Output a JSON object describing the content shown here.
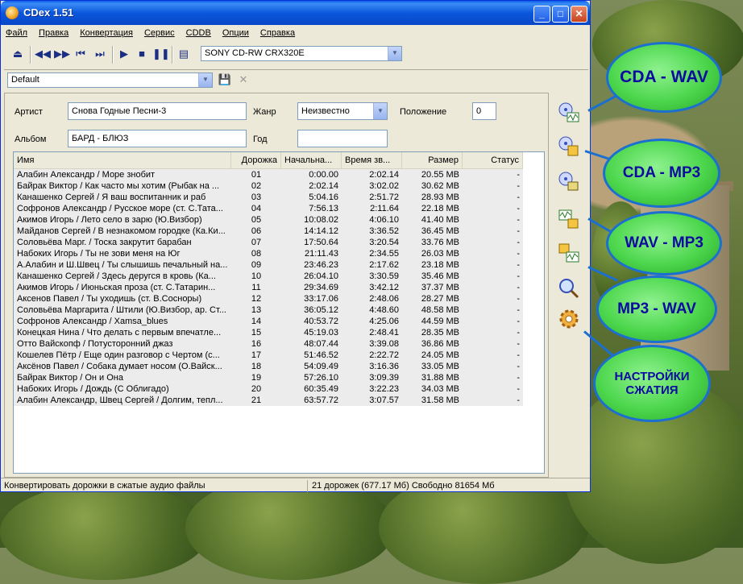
{
  "window": {
    "title": "CDex 1.51"
  },
  "menu": [
    "Файл",
    "Правка",
    "Конвертация",
    "Сервис",
    "CDDB",
    "Опции",
    "Справка"
  ],
  "toolbar": {
    "drive": "SONY    CD-RW  CRX320E"
  },
  "profile": {
    "value": "Default"
  },
  "form": {
    "artist_label": "Артист",
    "artist_value": "Снова Годные Песни-3",
    "genre_label": "Жанр",
    "genre_value": "Неизвестно",
    "position_label": "Положение",
    "position_value": "0",
    "album_label": "Альбом",
    "album_value": "БАРД - БЛЮЗ",
    "year_label": "Год",
    "year_value": ""
  },
  "table": {
    "columns": [
      "Имя",
      "Дорожка",
      "Начальна...",
      "Время зв...",
      "Размер",
      "Статус"
    ],
    "rows": [
      [
        "Алабин Александр / Море знобит",
        "01",
        "0:00.00",
        "2:02.14",
        "20.55 MB",
        "-"
      ],
      [
        "Байрак Виктор / Как часто мы хотим (Рыбак на ...",
        "02",
        "2:02.14",
        "3:02.02",
        "30.62 MB",
        "-"
      ],
      [
        "Канашенко Сергей / Я ваш воспитанник и раб",
        "03",
        "5:04.16",
        "2:51.72",
        "28.93 MB",
        "-"
      ],
      [
        "Софронов Александр / Русское море (ст. С.Тата...",
        "04",
        "7:56.13",
        "2:11.64",
        "22.18 MB",
        "-"
      ],
      [
        "Акимов Игорь / Лето село в зарю (Ю.Визбор)",
        "05",
        "10:08.02",
        "4:06.10",
        "41.40 MB",
        "-"
      ],
      [
        "Майданов Сергей / В незнакомом городке (Ка.Ки...",
        "06",
        "14:14.12",
        "3:36.52",
        "36.45 MB",
        "-"
      ],
      [
        "Соловьёва Марг. / Тоска закрутит барабан",
        "07",
        "17:50.64",
        "3:20.54",
        "33.76 MB",
        "-"
      ],
      [
        "Набоких Игорь / Ты не зови меня на Юг",
        "08",
        "21:11.43",
        "2:34.55",
        "26.03 MB",
        "-"
      ],
      [
        "А.Алабин и Ш.Швец / Ты слышишь печальный на...",
        "09",
        "23:46.23",
        "2:17.62",
        "23.18 MB",
        "-"
      ],
      [
        "Канашенко Сергей / Здесь деругся в кровь (Ка...",
        "10",
        "26:04.10",
        "3:30.59",
        "35.46 MB",
        "-"
      ],
      [
        "Акимов Игорь / Июньская проза (ст. С.Татарин...",
        "11",
        "29:34.69",
        "3:42.12",
        "37.37 MB",
        "-"
      ],
      [
        "Аксенов Павел / Ты уходишь (ст. В.Сосноры)",
        "12",
        "33:17.06",
        "2:48.06",
        "28.27 MB",
        "-"
      ],
      [
        "Соловьёва Маргарита / Штили (Ю.Визбор, ар. Ст...",
        "13",
        "36:05.12",
        "4:48.60",
        "48.58 MB",
        "-"
      ],
      [
        "Софронов Александр / Xamsa_blues",
        "14",
        "40:53.72",
        "4:25.06",
        "44.59 MB",
        "-"
      ],
      [
        "Конецкая Нина / Что делать с первым впечатле...",
        "15",
        "45:19.03",
        "2:48.41",
        "28.35 MB",
        "-"
      ],
      [
        "Отто Вайскопф / Потусторонний джаз",
        "16",
        "48:07.44",
        "3:39.08",
        "36.86 MB",
        "-"
      ],
      [
        "Кошелев Пётр / Еще один разговор с Чертом (с...",
        "17",
        "51:46.52",
        "2:22.72",
        "24.05 MB",
        "-"
      ],
      [
        "Аксёнов Павел / Собака думает носом (О.Вайск...",
        "18",
        "54:09.49",
        "3:16.36",
        "33.05 MB",
        "-"
      ],
      [
        "Байрак Виктор / Он и Она",
        "19",
        "57:26.10",
        "3:09.39",
        "31.88 MB",
        "-"
      ],
      [
        "Набоких Игорь / Дождь (С Облигадо)",
        "20",
        "60:35.49",
        "3:22.23",
        "34.03 MB",
        "-"
      ],
      [
        "Алабин Александр, Швец Сергей / Долгим, тепл...",
        "21",
        "63:57.72",
        "3:07.57",
        "31.58 MB",
        "-"
      ]
    ]
  },
  "status": {
    "left": "Конвертировать дорожки в сжатые аудио файлы",
    "right": "21 дорожек (677.17 Мб) Свободно 81654 Мб"
  },
  "callouts": {
    "cda_wav": "CDA - WAV",
    "cda_mp3": "CDA - MP3",
    "wav_mp3": "WAV - MP3",
    "mp3_wav": "MP3 - WAV",
    "settings": "НАСТРОЙКИ СЖАТИЯ"
  }
}
